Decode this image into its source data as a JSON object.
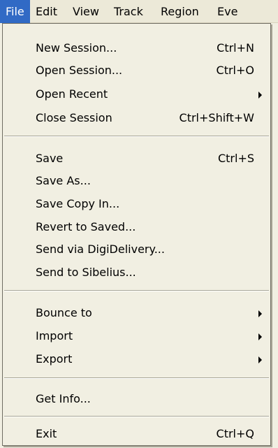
{
  "menubar": {
    "file": "File",
    "edit": "Edit",
    "view": "View",
    "track": "Track",
    "region": "Region",
    "event": "Eve"
  },
  "menu": {
    "new_session": {
      "label": "New Session...",
      "shortcut": "Ctrl+N"
    },
    "open_session": {
      "label": "Open Session...",
      "shortcut": "Ctrl+O"
    },
    "open_recent": {
      "label": "Open Recent"
    },
    "close_session": {
      "label": "Close Session",
      "shortcut": "Ctrl+Shift+W"
    },
    "save": {
      "label": "Save",
      "shortcut": "Ctrl+S"
    },
    "save_as": {
      "label": "Save As..."
    },
    "save_copy_in": {
      "label": "Save Copy In..."
    },
    "revert_to_saved": {
      "label": "Revert to Saved..."
    },
    "send_via_digidelivery": {
      "label": "Send via DigiDelivery..."
    },
    "send_to_sibelius": {
      "label": "Send to Sibelius..."
    },
    "bounce_to": {
      "label": "Bounce to"
    },
    "import": {
      "label": "Import"
    },
    "export": {
      "label": "Export"
    },
    "get_info": {
      "label": "Get Info..."
    },
    "exit": {
      "label": "Exit",
      "shortcut": "Ctrl+Q"
    }
  },
  "icons": {
    "submenu": "submenu-arrow-icon"
  },
  "colors": {
    "highlight": "#316ac5",
    "menu_bg": "#f1efe2",
    "menubar_bg": "#ece9d8"
  }
}
